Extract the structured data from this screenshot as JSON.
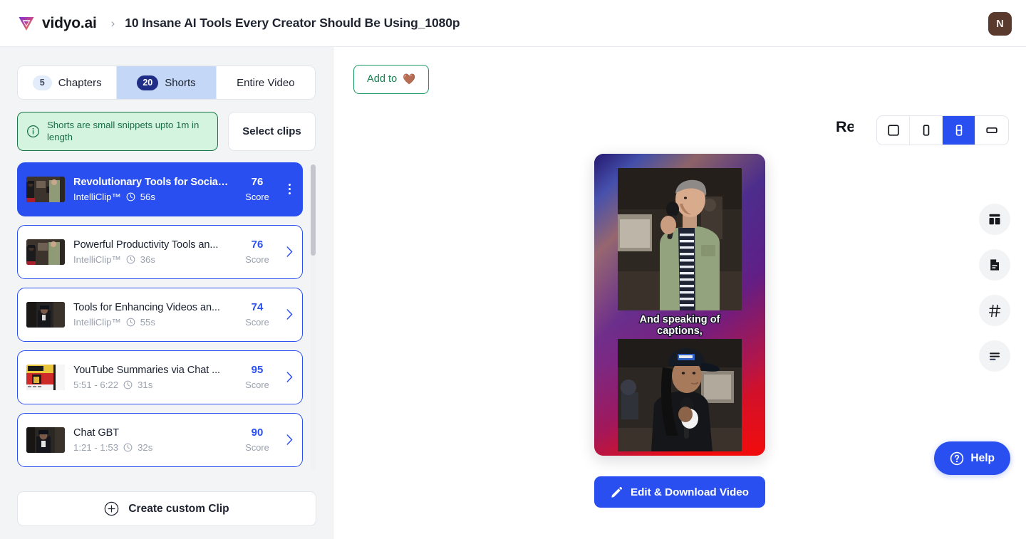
{
  "header": {
    "brand_name": "vidyo.ai",
    "breadcrumb_separator": "›",
    "project_title": "10 Insane AI Tools Every Creator Should Be Using_1080p",
    "avatar_initial": "N"
  },
  "left_panel": {
    "tabs": [
      {
        "count": "5",
        "label": "Chapters",
        "active": false
      },
      {
        "count": "20",
        "label": "Shorts",
        "active": true
      },
      {
        "count": "",
        "label": "Entire Video",
        "active": false
      }
    ],
    "notice": "Shorts are small snippets upto 1m in length",
    "select_clips_label": "Select clips",
    "create_custom_clip_label": "Create custom Clip",
    "clips": [
      {
        "title": "Revolutionary Tools for Social ...",
        "source": "IntelliClip™",
        "duration": "56s",
        "score": "76",
        "score_label": "Score",
        "selected": true
      },
      {
        "title": "Powerful Productivity Tools an...",
        "source": "IntelliClip™",
        "duration": "36s",
        "score": "76",
        "score_label": "Score",
        "selected": false
      },
      {
        "title": "Tools for Enhancing Videos an...",
        "source": "IntelliClip™",
        "duration": "55s",
        "score": "74",
        "score_label": "Score",
        "selected": false
      },
      {
        "title": "YouTube Summaries via Chat ...",
        "source": "5:51 - 6:22",
        "duration": "31s",
        "score": "95",
        "score_label": "Score",
        "selected": false
      },
      {
        "title": "Chat GBT",
        "source": "1:21 - 1:53",
        "duration": "32s",
        "score": "90",
        "score_label": "Score",
        "selected": false
      }
    ]
  },
  "right_panel": {
    "add_to_label": "Add to",
    "add_to_emoji": "🤎",
    "preview_title": "Revolutionary Tools for Social Media Content Creation",
    "ratio_buttons": [
      {
        "name": "square-ratio",
        "active": false
      },
      {
        "name": "portrait-ratio",
        "active": false
      },
      {
        "name": "split-ratio",
        "active": true
      },
      {
        "name": "landscape-ratio",
        "active": false
      }
    ],
    "video_caption": "And speaking of captions,",
    "edit_download_label": "Edit & Download Video",
    "rail_icons": [
      "layout-icon",
      "document-icon",
      "hashtag-icon",
      "text-align-icon"
    ],
    "help_label": "Help"
  },
  "colors": {
    "accent_blue": "#2a4ff0",
    "tab_active_bg": "#c4d7f7",
    "badge_dark": "#1f2d86",
    "notice_green_bg": "#d4f4e0",
    "notice_green_border": "#19794a",
    "avatar_brown": "#5b3a2e"
  }
}
